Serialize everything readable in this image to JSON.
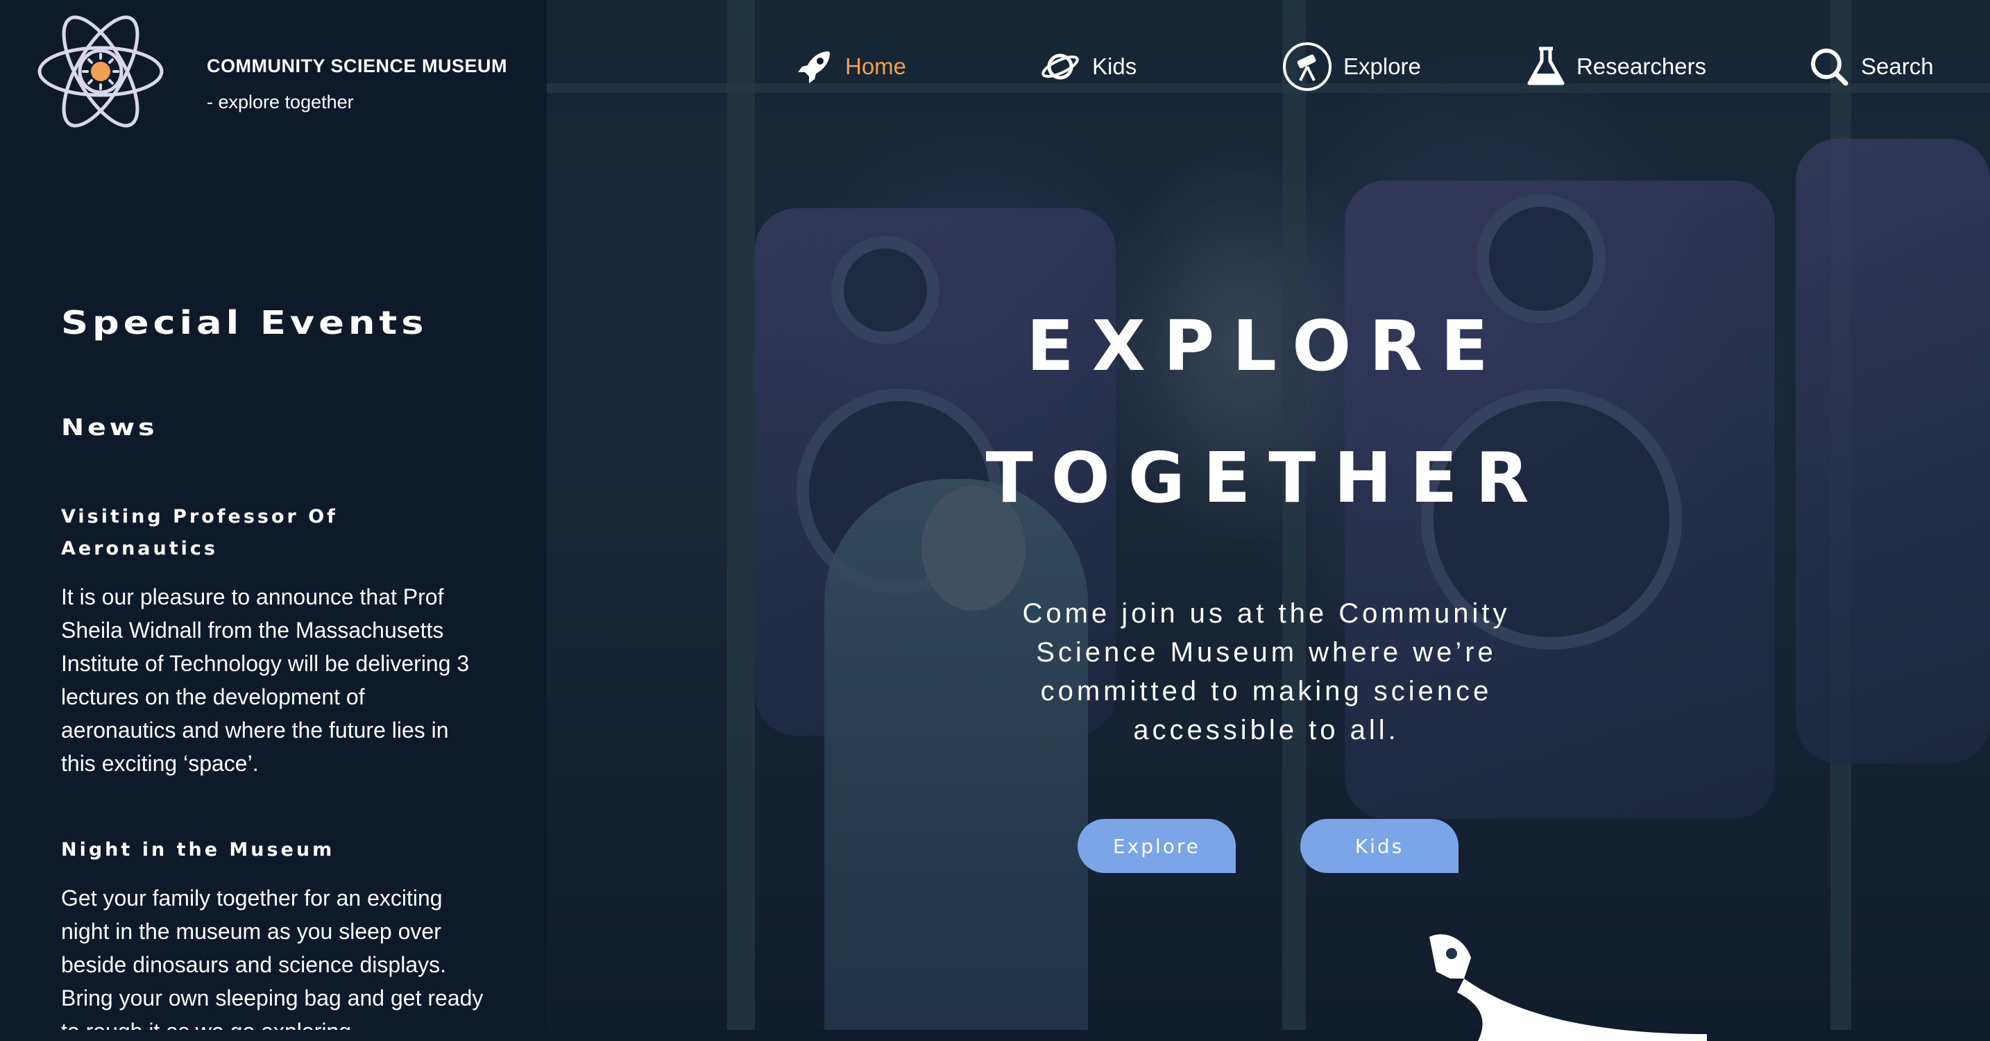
{
  "brand": {
    "name": "COMMUNITY SCIENCE MUSEUM",
    "tagline": "- explore together",
    "accent": "#f0a050",
    "logo_icon": "atom-icon"
  },
  "nav": {
    "items": [
      {
        "label": "Home",
        "icon": "rocket-icon",
        "active": true
      },
      {
        "label": "Kids",
        "icon": "planet-icon",
        "active": false
      },
      {
        "label": "Explore",
        "icon": "telescope-icon",
        "active": false
      },
      {
        "label": "Researchers",
        "icon": "flask-icon",
        "active": false
      },
      {
        "label": "Search",
        "icon": "search-icon",
        "active": false
      }
    ]
  },
  "sidebar": {
    "title": "Special Events",
    "subtitle": "News",
    "news": [
      {
        "heading": "Visiting Professor Of Aeronautics",
        "body": "It is our pleasure to announce that Prof Sheila Widnall from the Massachusetts Institute of Technology will be delivering 3 lectures on the development of aeronautics and where the future lies in this exciting ‘space’."
      },
      {
        "heading": "Night in the Museum",
        "body": "Get your family together for an exciting night in the museum as you sleep over beside dinosaurs and science displays. Bring your own sleeping bag and get ready to rough it as we go exploring..."
      }
    ]
  },
  "hero": {
    "title_line1": "EXPLORE",
    "title_line2": "TOGETHER",
    "description": "Come join us at the Community Science Museum where we’re committed to making science accessible to all.",
    "buttons": {
      "explore": "Explore",
      "kids": "Kids"
    },
    "button_color": "#7aa6e8"
  }
}
